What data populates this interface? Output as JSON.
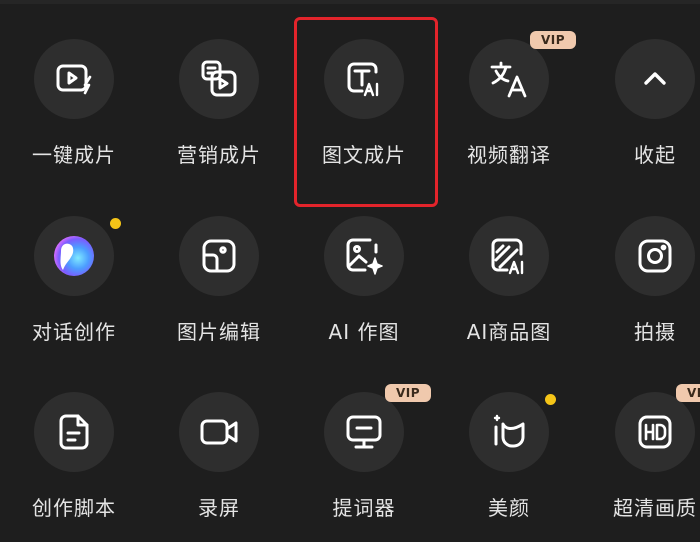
{
  "colors": {
    "background": "#1e1e1e",
    "circle": "#2e2e2e",
    "label": "#e4e4e4",
    "icon": "#ffffff",
    "vip_badge": "#f0c9ad",
    "vip_text": "#3a2a1c",
    "notification_dot": "#f5c518",
    "highlight_border": "#e3242b"
  },
  "tools": [
    {
      "id": "one-click-video",
      "label": "一键成片",
      "icon": "video-lightning-icon"
    },
    {
      "id": "marketing-video",
      "label": "营销成片",
      "icon": "marketing-video-icon"
    },
    {
      "id": "text-to-video",
      "label": "图文成片",
      "icon": "text-ai-icon",
      "highlighted": true
    },
    {
      "id": "video-translate",
      "label": "视频翻译",
      "icon": "translate-icon",
      "badge": "VIP"
    },
    {
      "id": "collapse",
      "label": "收起",
      "icon": "chevron-up-icon"
    },
    {
      "id": "chat-create",
      "label": "对话创作",
      "icon": "chat-orb-icon",
      "dot": true
    },
    {
      "id": "image-edit",
      "label": "图片编辑",
      "icon": "image-edit-icon"
    },
    {
      "id": "ai-draw",
      "label": "AI 作图",
      "icon": "image-sparkle-icon"
    },
    {
      "id": "ai-product-image",
      "label": "AI商品图",
      "icon": "ai-product-icon"
    },
    {
      "id": "capture",
      "label": "拍摄",
      "icon": "camera-icon"
    },
    {
      "id": "script",
      "label": "创作脚本",
      "icon": "document-icon"
    },
    {
      "id": "screen-record",
      "label": "录屏",
      "icon": "screen-record-icon"
    },
    {
      "id": "teleprompter",
      "label": "提词器",
      "icon": "teleprompter-icon",
      "badge": "VIP"
    },
    {
      "id": "beauty",
      "label": "美颜",
      "icon": "beauty-face-icon",
      "dot": true
    },
    {
      "id": "hd-enhance",
      "label": "超清画质",
      "icon": "hd-icon",
      "badge": "VIP"
    }
  ]
}
